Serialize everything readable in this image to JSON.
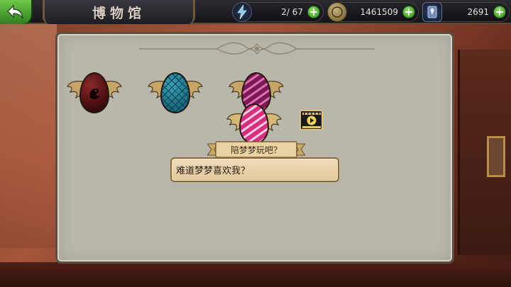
{
  "header": {
    "title": "博物馆",
    "back_icon": "back-arrow-icon"
  },
  "resources": {
    "stamina": {
      "icon": "lightning-icon",
      "value": "2/ 67"
    },
    "gold": {
      "icon": "coin-icon",
      "value": "1461509"
    },
    "gems": {
      "icon": "gem-card-icon",
      "value": "2691"
    },
    "plus_label": "+"
  },
  "eggs": [
    {
      "name": "black-egg",
      "color": "#6a1a1a"
    },
    {
      "name": "blue-egg",
      "color": "#2a8aa0"
    },
    {
      "name": "purple-egg",
      "color": "#7a1a55"
    }
  ],
  "dialog": {
    "speaker": "陪梦梦玩吧？",
    "text": "难道梦梦喜欢我？",
    "egg_color": "#d62f7f",
    "video_icon": "video-play-icon"
  },
  "colors": {
    "accent_green": "#3f9e2a",
    "panel": "#b9b7ac",
    "dialog_bg": "#e8d3ad"
  }
}
